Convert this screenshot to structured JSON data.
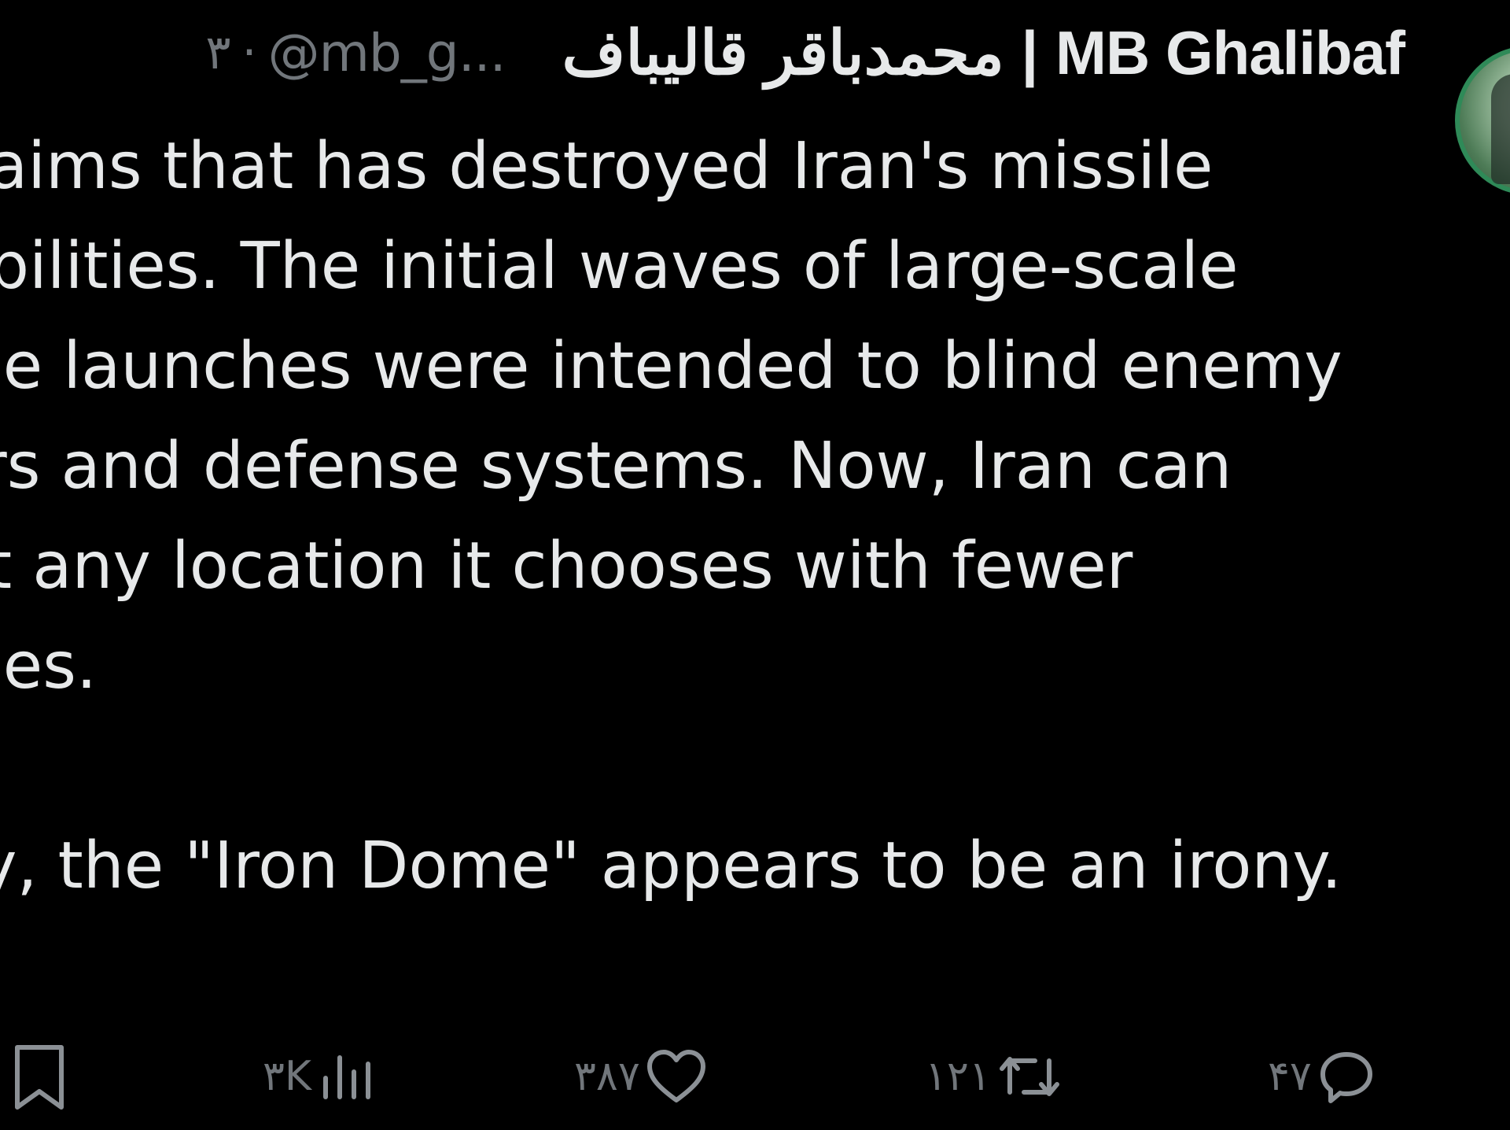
{
  "tweet": {
    "display_name": "محمدباقر قالیباف | MB Ghalibaf",
    "handle": "@mb_g...",
    "time": "۳",
    "separator": "·",
    "body_lines": [
      "aims that has destroyed Iran's missile",
      "bilities. The initial waves of large-scale",
      "le launches were intended to blind enemy",
      "rs and defense systems. Now, Iran can",
      "t any location it chooses with fewer",
      "les.",
      "",
      "y, the \"Iron Dome\" appears to be an irony."
    ]
  },
  "actions": {
    "replies": "۴۷",
    "reposts": "۱۲۱",
    "likes": "۳۸۷",
    "views": "۳K"
  },
  "colors": {
    "background": "#000000",
    "text": "#e7e9ea",
    "muted": "#71767b"
  }
}
